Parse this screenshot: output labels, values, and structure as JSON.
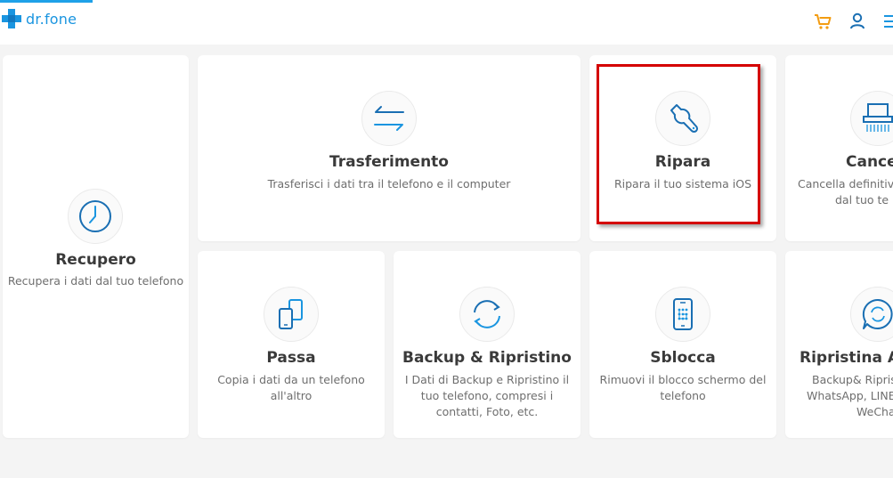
{
  "app": {
    "logo_text": "dr.fone"
  },
  "header": {
    "icons": [
      "cart-icon",
      "user-icon",
      "menu-icon"
    ]
  },
  "colors": {
    "accent": "#1a95e0",
    "cart": "#f39c12",
    "highlight": "#d40000"
  },
  "cards": [
    {
      "title": "Recupero",
      "desc": "Recupera i dati dal tuo telefono",
      "icon": "clock-icon"
    },
    {
      "title": "Trasferimento",
      "desc": "Trasferisci i dati tra il telefono e il computer",
      "icon": "transfer-arrows-icon"
    },
    {
      "title": "Ripara",
      "desc": "Ripara il tuo sistema iOS",
      "icon": "wrench-icon"
    },
    {
      "title": "Cancel",
      "desc_line1": "Cancella definitiv",
      "desc_line2": "dal tuo te",
      "icon": "shredder-icon"
    },
    {
      "title": "Passa",
      "desc_line1": "Copia i dati da un telefono",
      "desc_line2": "all'altro",
      "icon": "phone-switch-icon"
    },
    {
      "title": "Backup & Ripristino",
      "desc_line1": "I Dati di Backup e Ripristino il",
      "desc_line2": "tuo telefono, compresi i",
      "desc_line3": "contatti, Foto, etc.",
      "icon": "sync-icon"
    },
    {
      "title": "Sblocca",
      "desc_line1": "Rimuovi il blocco schermo del",
      "desc_line2": "telefono",
      "icon": "phone-unlock-icon"
    },
    {
      "title": "Ripristina Ap",
      "desc_line1": "Backup& Ripris",
      "desc_line2": "WhatsApp, LINE",
      "desc_line3": "WeCha",
      "icon": "chat-restore-icon"
    }
  ]
}
